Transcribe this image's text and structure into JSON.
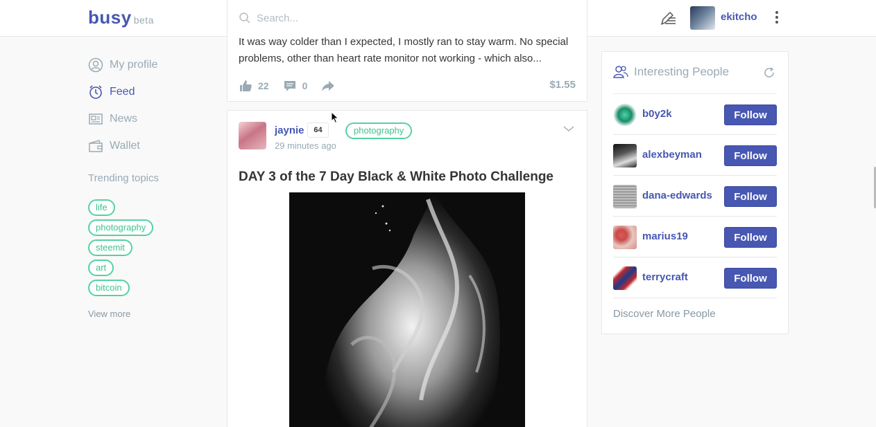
{
  "header": {
    "logo": "busy",
    "logo_badge": "beta",
    "search_placeholder": "Search...",
    "username": "ekitcho"
  },
  "sidebar": {
    "nav": [
      {
        "label": "My profile",
        "icon": "user-circle-icon",
        "active": false
      },
      {
        "label": "Feed",
        "icon": "clock-icon",
        "active": true
      },
      {
        "label": "News",
        "icon": "news-icon",
        "active": false
      },
      {
        "label": "Wallet",
        "icon": "wallet-icon",
        "active": false
      }
    ],
    "trending_title": "Trending topics",
    "tags": [
      "life",
      "photography",
      "steemit",
      "art",
      "bitcoin"
    ],
    "view_more": "View more"
  },
  "feed": {
    "post1": {
      "excerpt": "It was way colder than I expected, I mostly ran to stay warm. No special problems, other than heart rate monitor not working - which also...",
      "likes": "22",
      "comments": "0",
      "payout": "$1.55"
    },
    "post2": {
      "author": "jaynie",
      "reputation": "64",
      "tag": "photography",
      "time": "29 minutes ago",
      "title": "DAY 3 of the 7 Day Black & White Photo Challenge"
    }
  },
  "people_panel": {
    "title": "Interesting People",
    "follow_label": "Follow",
    "people": [
      {
        "name": "b0y2k"
      },
      {
        "name": "alexbeyman"
      },
      {
        "name": "dana-edwards"
      },
      {
        "name": "marius19"
      },
      {
        "name": "terrycraft"
      }
    ],
    "discover": "Discover More People"
  },
  "colors": {
    "brand": "#4757b2",
    "tag_green": "#54d2a0",
    "muted": "#99aab5"
  }
}
